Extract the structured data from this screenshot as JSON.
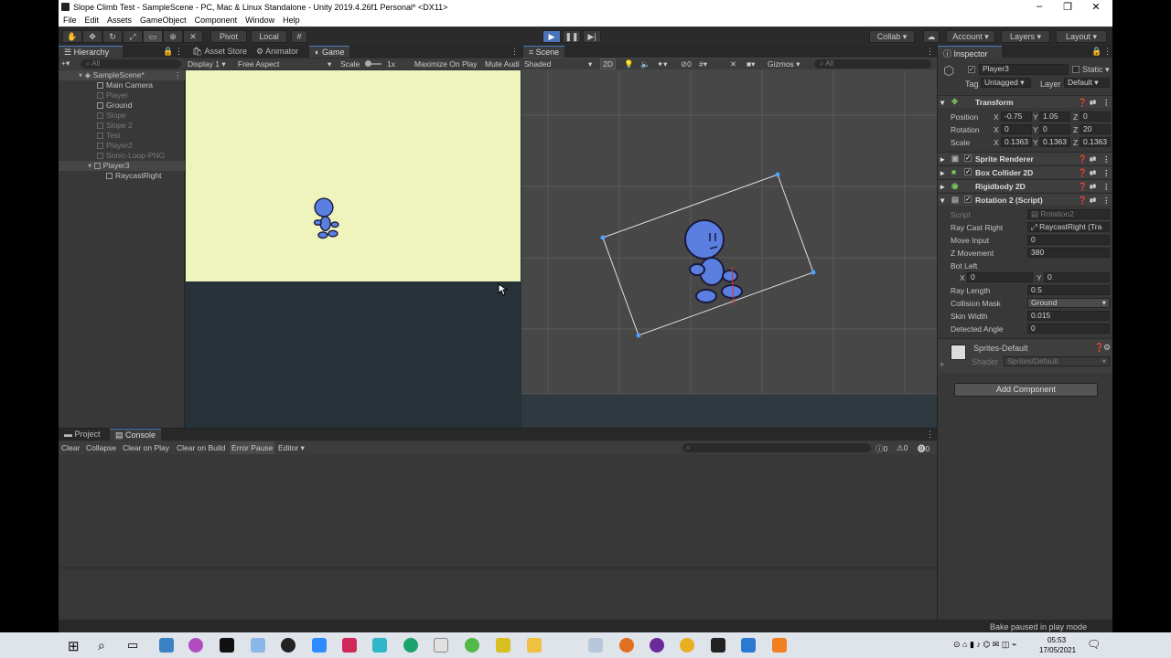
{
  "window": {
    "title": "Slope Climb Test - SampleScene - PC, Mac & Linux Standalone - Unity 2019.4.26f1 Personal* <DX11>"
  },
  "menu": [
    "File",
    "Edit",
    "Assets",
    "GameObject",
    "Component",
    "Window",
    "Help"
  ],
  "toolbar": {
    "pivot": "Pivot",
    "local": "Local",
    "collab": "Collab",
    "account": "Account",
    "layers": "Layers",
    "layout": "Layout"
  },
  "hierarchy": {
    "tab": "Hierarchy",
    "search_placeholder": "All",
    "scene": "SampleScene*",
    "items": [
      {
        "label": "Main Camera",
        "dim": false
      },
      {
        "label": "Player",
        "dim": true
      },
      {
        "label": "Ground",
        "dim": false
      },
      {
        "label": "Slope",
        "dim": true
      },
      {
        "label": "Slope 2",
        "dim": true
      },
      {
        "label": "Test",
        "dim": true
      },
      {
        "label": "Player2",
        "dim": true
      },
      {
        "label": "Sonic-Loop-PNG",
        "dim": true
      },
      {
        "label": "Player3",
        "dim": false
      },
      {
        "label": "RaycastRight",
        "dim": false
      }
    ]
  },
  "tabs": {
    "asset_store": "Asset Store",
    "animator": "Animator",
    "game": "Game",
    "scene": "Scene",
    "inspector": "Inspector",
    "project": "Project",
    "console": "Console"
  },
  "game_bar": {
    "display": "Display 1",
    "aspect": "Free Aspect",
    "scale_label": "Scale",
    "scale_value": "1x",
    "maximize": "Maximize On Play",
    "mute": "Mute Audi"
  },
  "scene_bar": {
    "shading": "Shaded",
    "mode_2d": "2D",
    "fx_count": "0",
    "gizmos": "Gizmos",
    "search_placeholder": "All"
  },
  "inspector": {
    "object_name": "Player3",
    "static_label": "Static",
    "tag_label": "Tag",
    "tag_value": "Untagged",
    "layer_label": "Layer",
    "layer_value": "Default",
    "transform": "Transform",
    "position_label": "Position",
    "position": {
      "x": "-0.75",
      "y": "1.05",
      "z": "0"
    },
    "rotation_label": "Rotation",
    "rotation": {
      "x": "0",
      "y": "0",
      "z": "20"
    },
    "scale_label": "Scale",
    "scale": {
      "x": "0.1363",
      "y": "0.1363",
      "z": "0.1363"
    },
    "components": [
      "Sprite Renderer",
      "Box Collider 2D",
      "Rigidbody 2D",
      "Rotation 2 (Script)"
    ],
    "script_label": "Script",
    "script_value": "Rotation2",
    "fields": [
      {
        "label": "Ray Cast Right",
        "value": "RaycastRight (Tra"
      },
      {
        "label": "Move Input",
        "value": "0"
      },
      {
        "label": "Z Movement",
        "value": "380"
      },
      {
        "label": "Bot Left",
        "value": ""
      }
    ],
    "bot_left": {
      "x": "0",
      "y": "0"
    },
    "fields2": [
      {
        "label": "Ray Length",
        "value": "0.5"
      },
      {
        "label": "Collision Mask",
        "value": "Ground"
      },
      {
        "label": "Skin Width",
        "value": "0.015"
      },
      {
        "label": "Detected Angle",
        "value": "0"
      }
    ],
    "material_name": "Sprites-Default",
    "shader_label": "Shader",
    "shader_value": "Sprites/Default",
    "add_component": "Add Component"
  },
  "console": {
    "buttons": [
      "Clear",
      "Collapse",
      "Clear on Play",
      "Clear on Build",
      "Error Pause",
      "Editor"
    ],
    "info_count": "0",
    "warn_count": "0",
    "error_count": "0"
  },
  "status": {
    "bake": "Bake paused in play mode"
  },
  "taskbar": {
    "time": "05:53",
    "date": "17/05/2021"
  },
  "colors": {
    "editor_bg": "#383838",
    "game_bg": "#eef4bc",
    "play_blue": "#4a74b9",
    "character_blue": "#5b7fe0"
  }
}
